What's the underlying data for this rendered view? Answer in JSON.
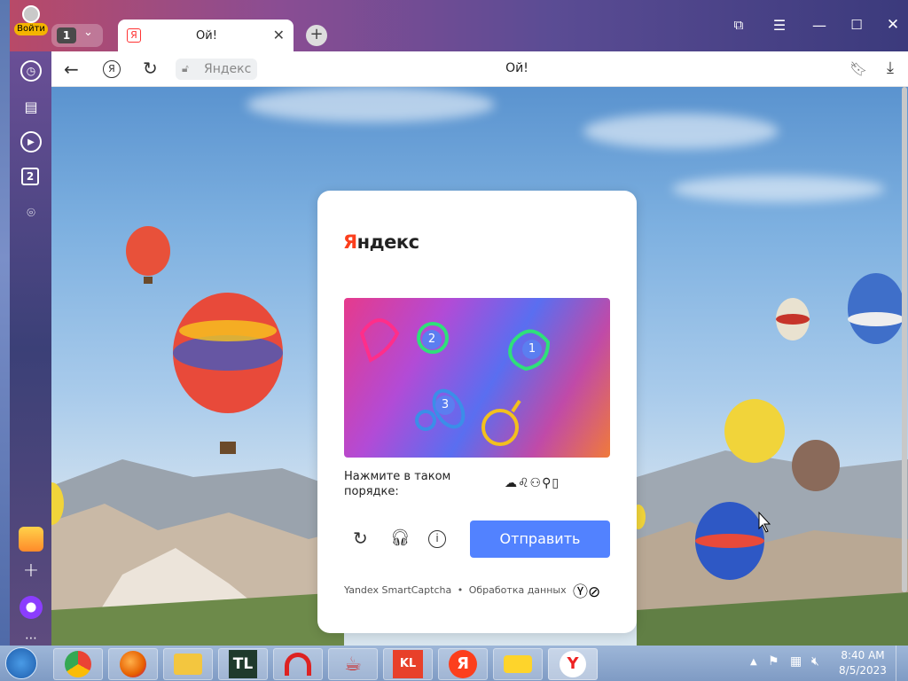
{
  "browser": {
    "signin_label": "Войти",
    "tab_count": "1",
    "tab_title": "Ой!",
    "page_title": "Ой!",
    "address_text": "Яндекс",
    "left_panel_badge": "2"
  },
  "captcha": {
    "brand": "Яндекс",
    "instruction": "Нажмите в таком порядке:",
    "submit_label": "Отправить",
    "footer_brand": "Yandex SmartCaptcha",
    "footer_sep": "•",
    "footer_link": "Обработка данных",
    "markers": [
      "1",
      "2",
      "3"
    ]
  },
  "taskbar": {
    "time": "8:40 AM",
    "date": "8/5/2023",
    "tl_label": "TL",
    "kl_label": "KL",
    "ya_label": "Я"
  },
  "colors": {
    "accent": "#5282ff",
    "brand_red": "#fc3f1d"
  }
}
